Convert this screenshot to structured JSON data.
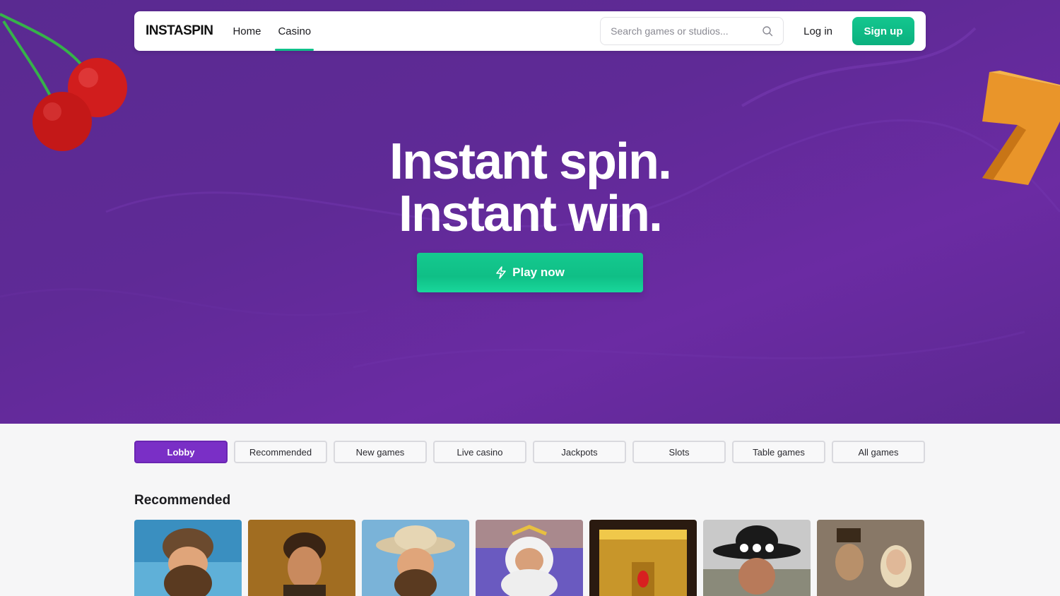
{
  "brand": {
    "logo_text": "INSTASPIN"
  },
  "nav": {
    "links": [
      {
        "label": "Home",
        "active": false
      },
      {
        "label": "Casino",
        "active": true
      }
    ],
    "search_placeholder": "Search games or studios...",
    "login_label": "Log in",
    "signup_label": "Sign up"
  },
  "hero": {
    "title_line1": "Instant spin.",
    "title_line2": "Instant win.",
    "play_label": "Play now",
    "background_color": "#5f2a96"
  },
  "tabs": [
    {
      "label": "Lobby",
      "active": true
    },
    {
      "label": "Recommended",
      "active": false
    },
    {
      "label": "New games",
      "active": false
    },
    {
      "label": "Live casino",
      "active": false
    },
    {
      "label": "Jackpots",
      "active": false
    },
    {
      "label": "Slots",
      "active": false
    },
    {
      "label": "Table games",
      "active": false
    },
    {
      "label": "All games",
      "active": false
    }
  ],
  "recommended": {
    "title": "Recommended",
    "games": [
      {
        "art": "bearded-explorer-beanie",
        "bg": "#3a8fc0"
      },
      {
        "art": "dark-haired-adventurer",
        "bg": "#8a5a1c"
      },
      {
        "art": "cowboy-hat-explorer",
        "bg": "#7ab3d8"
      },
      {
        "art": "zeus-god",
        "bg": "#6a5ac0"
      },
      {
        "art": "golden-temple",
        "bg": "#c8962a"
      },
      {
        "art": "outlaw-black-hat",
        "bg": "#c9c9c9"
      },
      {
        "art": "steampunk-couple",
        "bg": "#7a6a5a"
      }
    ]
  },
  "colors": {
    "accent_green": "#11c08a",
    "accent_purple": "#7a2fc6"
  }
}
